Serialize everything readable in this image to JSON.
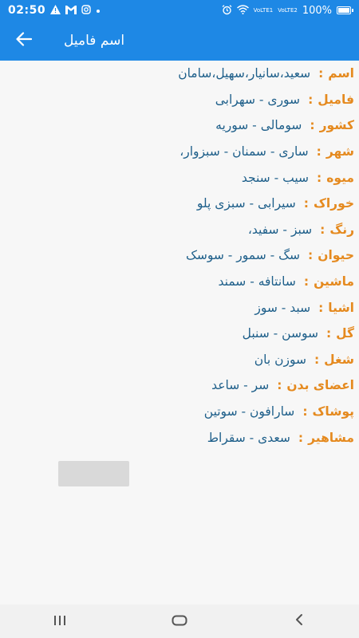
{
  "status_bar": {
    "time": "02:50",
    "left_icons": [
      "warning-icon",
      "gmail-icon",
      "instagram-icon",
      "dot-icon"
    ],
    "right_icons": [
      "alarm-icon",
      "wifi-icon",
      "volte1-icon",
      "volte2-icon"
    ],
    "volte1": "VoLTE1",
    "volte2": "VoLTE2",
    "battery": "100%"
  },
  "app_bar": {
    "title": "اسم فامیل",
    "color": "#1e88e5"
  },
  "items": [
    {
      "label": "اسم",
      "colon": ":",
      "value": "سعید،سانیار،سهیل،سامان"
    },
    {
      "label": "فامیل",
      "colon": ":",
      "value": "سوری - سهرابی"
    },
    {
      "label": "کشور",
      "colon": ":",
      "value": "سومالی - سوریه"
    },
    {
      "label": "شهر",
      "colon": ":",
      "value": "ساری - سمنان - سبزوار،"
    },
    {
      "label": "میوه",
      "colon": ":",
      "value": "سیب - سنجد"
    },
    {
      "label": "خوراک",
      "colon": ":",
      "value": "سیرابی - سبزی پلو"
    },
    {
      "label": "رنگ",
      "colon": ":",
      "value": "سبز - سفید،"
    },
    {
      "label": "حیوان",
      "colon": ":",
      "value": "سگ - سمور - سوسک"
    },
    {
      "label": "ماشین",
      "colon": ":",
      "value": "سانتافه - سمند"
    },
    {
      "label": "اشیا",
      "colon": ":",
      "value": "سبد - سوز"
    },
    {
      "label": "گل",
      "colon": ":",
      "value": "سوسن - سنبل"
    },
    {
      "label": "شغل",
      "colon": ":",
      "value": "سوزن بان"
    },
    {
      "label": "اعضای بدن",
      "colon": ":",
      "value": "سر - ساعد"
    },
    {
      "label": "پوشاک",
      "colon": ":",
      "value": "سارافون - سوتین"
    },
    {
      "label": "مشاهیر",
      "colon": ":",
      "value": "سعدی - سقراط"
    }
  ],
  "colors": {
    "label": "#e58a1f",
    "value": "#1e5f8a",
    "background": "#f7f7f7"
  },
  "nav_bar": {
    "icons": [
      "recent-apps-icon",
      "home-icon",
      "back-nav-icon"
    ]
  }
}
